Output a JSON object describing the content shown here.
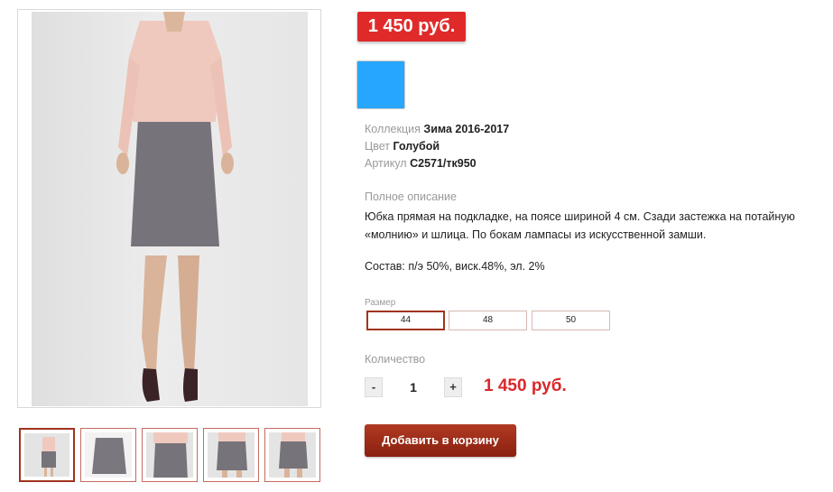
{
  "product": {
    "price_badge": "1 450 руб.",
    "color_value_hex": "#27a6ff",
    "properties": [
      {
        "label": "Коллекция",
        "value": "Зима 2016-2017"
      },
      {
        "label": "Цвет",
        "value": "Голубой"
      },
      {
        "label": "Артикул",
        "value": "С2571/тк950"
      }
    ],
    "description_title": "Полное описание",
    "description": "Юбка прямая на подкладке, на поясе шириной 4 см. Сзади застежка на потайную «молнию» и шлица. По бокам лампасы из искусственной замши.",
    "composition": "Состав: п/э 50%, виск.48%, эл. 2%",
    "size_title": "Размер",
    "sizes": [
      "44",
      "48",
      "50"
    ],
    "selected_size": "44",
    "quantity_title": "Количество",
    "quantity_minus": "-",
    "quantity_value": "1",
    "quantity_plus": "+",
    "total_price": "1 450 руб.",
    "add_to_cart": "Добавить в корзину"
  },
  "gallery": {
    "thumbnail_count": 5,
    "selected_thumbnail": 1
  },
  "colors": {
    "accent_red": "#e02a2a",
    "button_red": "#9b2b16",
    "selected_border": "#a1331f"
  }
}
